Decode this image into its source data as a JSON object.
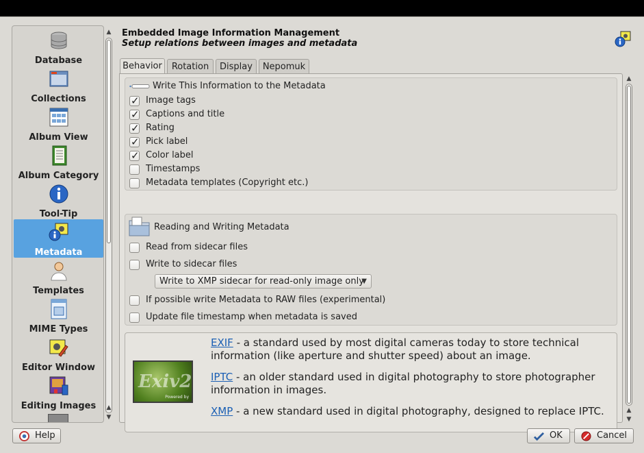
{
  "sidebar": {
    "items": [
      {
        "label": "Database",
        "icon": "database-icon"
      },
      {
        "label": "Collections",
        "icon": "collections-icon"
      },
      {
        "label": "Album View",
        "icon": "album-view-icon"
      },
      {
        "label": "Album Category",
        "icon": "album-category-icon"
      },
      {
        "label": "Tool-Tip",
        "icon": "info-icon"
      },
      {
        "label": "Metadata",
        "icon": "metadata-icon",
        "active": true
      },
      {
        "label": "Templates",
        "icon": "templates-icon"
      },
      {
        "label": "MIME Types",
        "icon": "mime-types-icon"
      },
      {
        "label": "Editor Window",
        "icon": "editor-window-icon"
      },
      {
        "label": "Editing Images",
        "icon": "editing-images-icon"
      }
    ]
  },
  "header": {
    "title": "Embedded Image Information Management",
    "subtitle": "Setup relations between images and metadata"
  },
  "tabs": [
    {
      "label": "Behavior",
      "active": true
    },
    {
      "label": "Rotation"
    },
    {
      "label": "Display"
    },
    {
      "label": "Nepomuk"
    }
  ],
  "write_group": {
    "title": "Write This Information to the Metadata",
    "options": [
      {
        "label": "Image tags",
        "checked": true
      },
      {
        "label": "Captions and title",
        "checked": true
      },
      {
        "label": "Rating",
        "checked": true
      },
      {
        "label": "Pick label",
        "checked": true
      },
      {
        "label": "Color label",
        "checked": true
      },
      {
        "label": "Timestamps",
        "checked": false
      },
      {
        "label": "Metadata templates (Copyright etc.)",
        "checked": false
      }
    ]
  },
  "rw_group": {
    "title": "Reading and Writing Metadata",
    "read_sidecar": {
      "label": "Read from sidecar files",
      "checked": false
    },
    "write_sidecar": {
      "label": "Write to sidecar files",
      "checked": false
    },
    "sidecar_mode": "Write to XMP sidecar for read-only image only",
    "write_raw": {
      "label": "If possible write Metadata to RAW files (experimental)",
      "checked": false
    },
    "update_timestamp": {
      "label": "Update file timestamp when metadata is saved",
      "checked": false
    }
  },
  "info": {
    "logo_text": "Exiv2",
    "logo_caption": "Powered by",
    "exif_link": "EXIF",
    "exif_text": " - a standard used by most digital cameras today to store technical information (like aperture and shutter speed) about an image.",
    "iptc_link": "IPTC",
    "iptc_text": " - an older standard used in digital photography to store photographer information in images.",
    "xmp_link": "XMP",
    "xmp_text": " - a new standard used in digital photography, designed to replace IPTC."
  },
  "buttons": {
    "help": "Help",
    "ok": "OK",
    "cancel": "Cancel"
  },
  "colors": {
    "selection": "#58a2e0",
    "link": "#1a5fb4"
  }
}
